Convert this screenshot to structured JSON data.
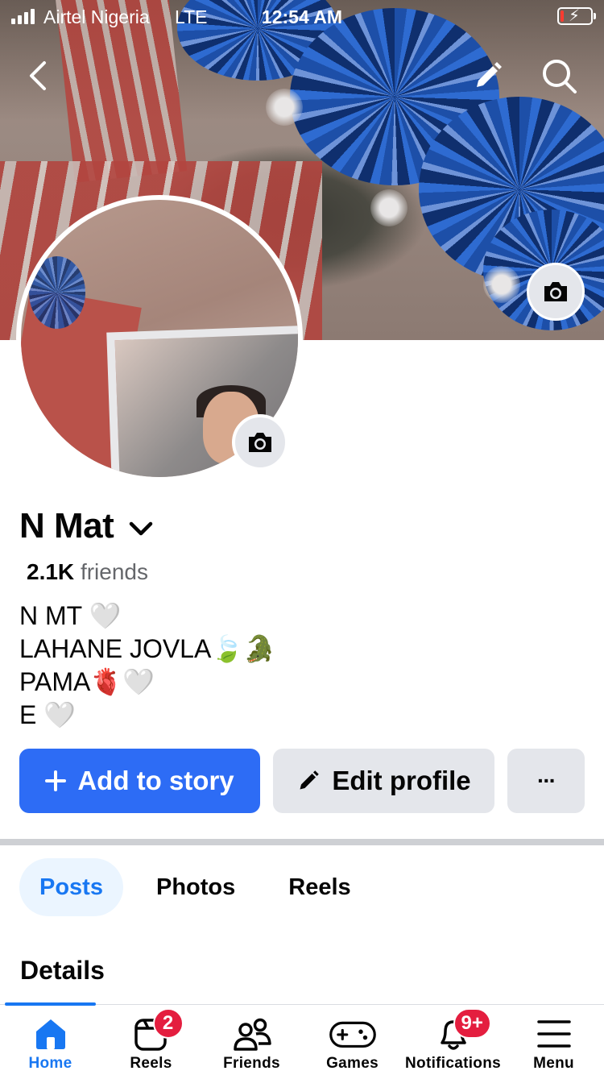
{
  "status_bar": {
    "carrier": "Airtel Nigeria",
    "network": "LTE",
    "time": "12:54 AM",
    "battery_level": 0.1,
    "charging": true
  },
  "header": {
    "back_icon": "chevron-left-icon",
    "edit_icon": "pencil-icon",
    "search_icon": "search-icon"
  },
  "profile": {
    "name": "N Mat",
    "friends_count": "2.1K",
    "friends_label": "friends",
    "bio": [
      "N MT 🤍",
      "LAHANE JOVLA🍃🐊",
      "PAMA🫀🤍",
      "E 🤍"
    ]
  },
  "actions": {
    "add_story_label": "Add to story",
    "edit_profile_label": "Edit profile",
    "more_label": "···"
  },
  "tabs": [
    {
      "label": "Posts",
      "active": true
    },
    {
      "label": "Photos",
      "active": false
    },
    {
      "label": "Reels",
      "active": false
    }
  ],
  "details_heading": "Details",
  "bottom_nav": [
    {
      "label": "Home",
      "icon": "home-icon",
      "active": true,
      "badge": ""
    },
    {
      "label": "Reels",
      "icon": "reels-icon",
      "active": false,
      "badge": "2"
    },
    {
      "label": "Friends",
      "icon": "friends-icon",
      "active": false,
      "badge": ""
    },
    {
      "label": "Games",
      "icon": "gamepad-icon",
      "active": false,
      "badge": ""
    },
    {
      "label": "Notifications",
      "icon": "bell-icon",
      "active": false,
      "badge": "9+"
    },
    {
      "label": "Menu",
      "icon": "menu-icon",
      "active": false,
      "badge": ""
    }
  ],
  "colors": {
    "accent": "#1877f2",
    "primary_button": "#2d6cf5",
    "secondary_button": "#e4e6eb",
    "badge": "#e41e3f"
  }
}
